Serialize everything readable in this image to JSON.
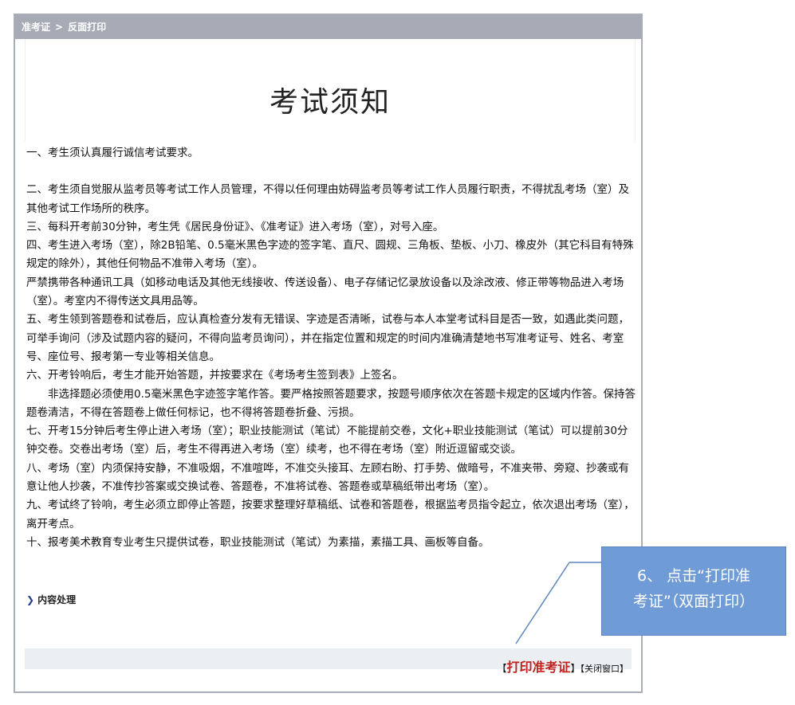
{
  "breadcrumb": {
    "item1": "准考证",
    "sep": ">",
    "item2": "反面打印"
  },
  "page_title": "考试须知",
  "notice": [
    "一、考生须认真履行诚信考试要求。",
    "二、考生须自觉服从监考员等考试工作人员管理，不得以任何理由妨碍监考员等考试工作人员履行职责，不得扰乱考场（室）及其他考试工作场所的秩序。",
    "三、每科开考前30分钟，考生凭《居民身份证》、《准考证》进入考场（室），对号入座。",
    "四、考生进入考场（室），除2B铅笔、0.5毫米黑色字迹的签字笔、直尺、圆规、三角板、垫板、小刀、橡皮外（其它科目有特殊规定的除外），其他任何物品不准带入考场（室）。",
    "严禁携带各种通讯工具（如移动电话及其他无线接收、传送设备）、电子存储记忆录放设备以及涂改液、修正带等物品进入考场（室）。考室内不得传送文具用品等。",
    "五、考生领到答题卷和试卷后，应认真检查分发有无错误、字迹是否清晰，试卷与本人本堂考试科目是否一致，如遇此类问题，可举手询问（涉及试题内容的疑问，不得向监考员询问），并在指定位置和规定的时间内准确清楚地书写准考证号、姓名、考室号、座位号、报考第一专业等相关信息。",
    "六、开考铃响后，考生才能开始答题，并按要求在《考场考生签到表》上签名。",
    "非选择题必须使用0.5毫米黑色字迹签字笔作答。要严格按照答题要求，按题号顺序依次在答题卡规定的区域内作答。保持答题卷清洁，不得在答题卷上做任何标记，也不得将答题卷折叠、污损。",
    "七、开考15分钟后考生停止进入考场（室）；职业技能测试（笔试）不能提前交卷，文化+职业技能测试（笔试）可以提前30分钟交卷。交卷出考场（室）后，考生不得再进入考场（室）续考，也不得在考场（室）附近逗留或交谈。",
    "八、考场（室）内须保持安静，不准吸烟，不准喧哗，不准交头接耳、左顾右盼、打手势、做暗号，不准夹带、旁窥、抄袭或有意让他人抄袭，不准传抄答案或交换试卷、答题卷，不准将试卷、答题卷或草稿纸带出考场（室）。",
    "九、考试终了铃响，考生必须立即停止答题，按要求整理好草稿纸、试卷和答题卷，根据监考员指令起立，依次退出考场（室），离开考点。",
    "十、报考美术教育专业考生只提供试卷，职业技能测试（笔试）为素描，素描工具、画板等自备。"
  ],
  "content_processing": "内容处理",
  "actions": {
    "bracket_open": "【",
    "print": "打印准考证",
    "bracket_close": "】",
    "close": "【关闭窗口】"
  },
  "callout": {
    "line1": "6、 点击“打印准",
    "line2": "考证”（双面打印）"
  },
  "colors": {
    "header_bg": "#a6abb6",
    "print_link": "#c0221e",
    "callout_bg": "#6f9cd7"
  }
}
